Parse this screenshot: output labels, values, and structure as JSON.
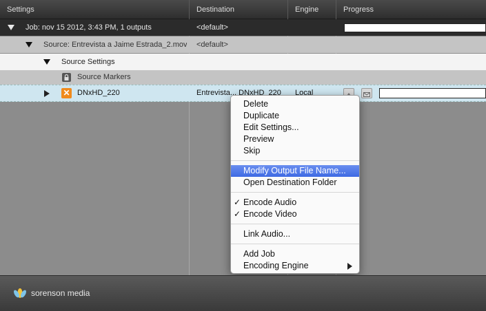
{
  "header": {
    "settings": "Settings",
    "destination": "Destination",
    "engine": "Engine",
    "progress": "Progress"
  },
  "rows": {
    "job": {
      "label": "Job: nov 15 2012, 3:43 PM, 1 outputs",
      "destination": "<default>"
    },
    "source": {
      "label": "Source: Entrevista a Jaime Estrada_2.mov",
      "destination": "<default>"
    },
    "source_settings": {
      "label": "Source Settings"
    },
    "source_markers": {
      "label": "Source Markers",
      "icon": "lock-icon"
    },
    "output": {
      "label": "DNxHD_220",
      "destination": "Entrevista... DNxHD_220",
      "engine": "Local",
      "icon": "x-icon"
    }
  },
  "context_menu": {
    "items": [
      {
        "label": "Delete"
      },
      {
        "label": "Duplicate"
      },
      {
        "label": "Edit Settings..."
      },
      {
        "label": "Preview"
      },
      {
        "label": "Skip"
      },
      {
        "label": "Modify Output File Name..."
      },
      {
        "label": "Open Destination Folder"
      },
      {
        "label": "Encode Audio",
        "checked": true
      },
      {
        "label": "Encode Video",
        "checked": true
      },
      {
        "label": "Link Audio..."
      },
      {
        "label": "Add Job"
      },
      {
        "label": "Encoding Engine",
        "submenu": true
      }
    ],
    "check_glyph": "✓"
  },
  "footer": {
    "logo_text": "sorenson media"
  },
  "colors": {
    "menu_highlight": "#3e6ae3",
    "output_row": "#cfe6f0",
    "brand_orange": "#f08a1c"
  }
}
